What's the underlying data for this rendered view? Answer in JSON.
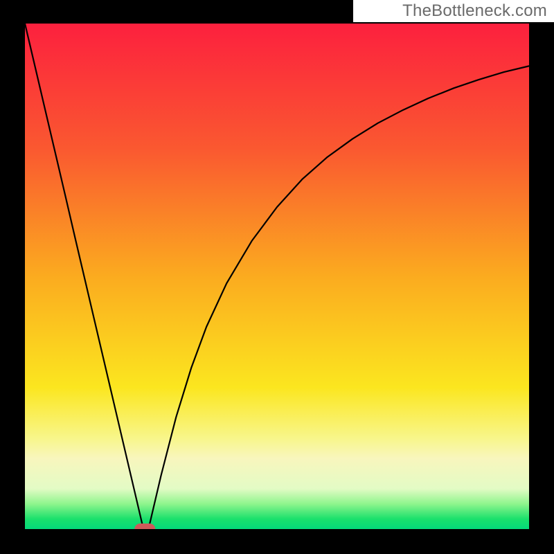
{
  "watermark": "TheBottleneck.com",
  "chart_data": {
    "type": "line",
    "title": "",
    "xlabel": "",
    "ylabel": "",
    "xlim": [
      0,
      100
    ],
    "ylim": [
      0,
      100
    ],
    "x": [
      0,
      2,
      4,
      6,
      8,
      10,
      12,
      14,
      16,
      18,
      20,
      22,
      23.5,
      24,
      24.5,
      25,
      27,
      30,
      33,
      36,
      40,
      45,
      50,
      55,
      60,
      65,
      70,
      75,
      80,
      85,
      90,
      95,
      100
    ],
    "values": [
      100,
      91.5,
      83.0,
      74.5,
      66.0,
      57.4,
      48.9,
      40.4,
      31.9,
      23.4,
      14.9,
      6.4,
      0.0,
      0.0,
      0.0,
      2.1,
      10.6,
      22.2,
      31.9,
      40.0,
      48.6,
      57.0,
      63.7,
      69.2,
      73.6,
      77.2,
      80.3,
      82.9,
      85.2,
      87.2,
      88.9,
      90.4,
      91.6
    ],
    "min_x": 23.8,
    "marker": {
      "x": 23.8,
      "y": 0.0,
      "color": "#cf5a5a"
    },
    "gradient_stops": [
      {
        "pct": 0.0,
        "color": "#fc203e"
      },
      {
        "pct": 0.25,
        "color": "#fa5930"
      },
      {
        "pct": 0.5,
        "color": "#fbab1f"
      },
      {
        "pct": 0.72,
        "color": "#fbe61f"
      },
      {
        "pct": 0.82,
        "color": "#f8f68a"
      },
      {
        "pct": 0.86,
        "color": "#f8f6bd"
      },
      {
        "pct": 0.92,
        "color": "#e3fbc5"
      },
      {
        "pct": 0.95,
        "color": "#8ff58d"
      },
      {
        "pct": 0.98,
        "color": "#1ae06c"
      },
      {
        "pct": 1.0,
        "color": "#04d97a"
      }
    ]
  }
}
